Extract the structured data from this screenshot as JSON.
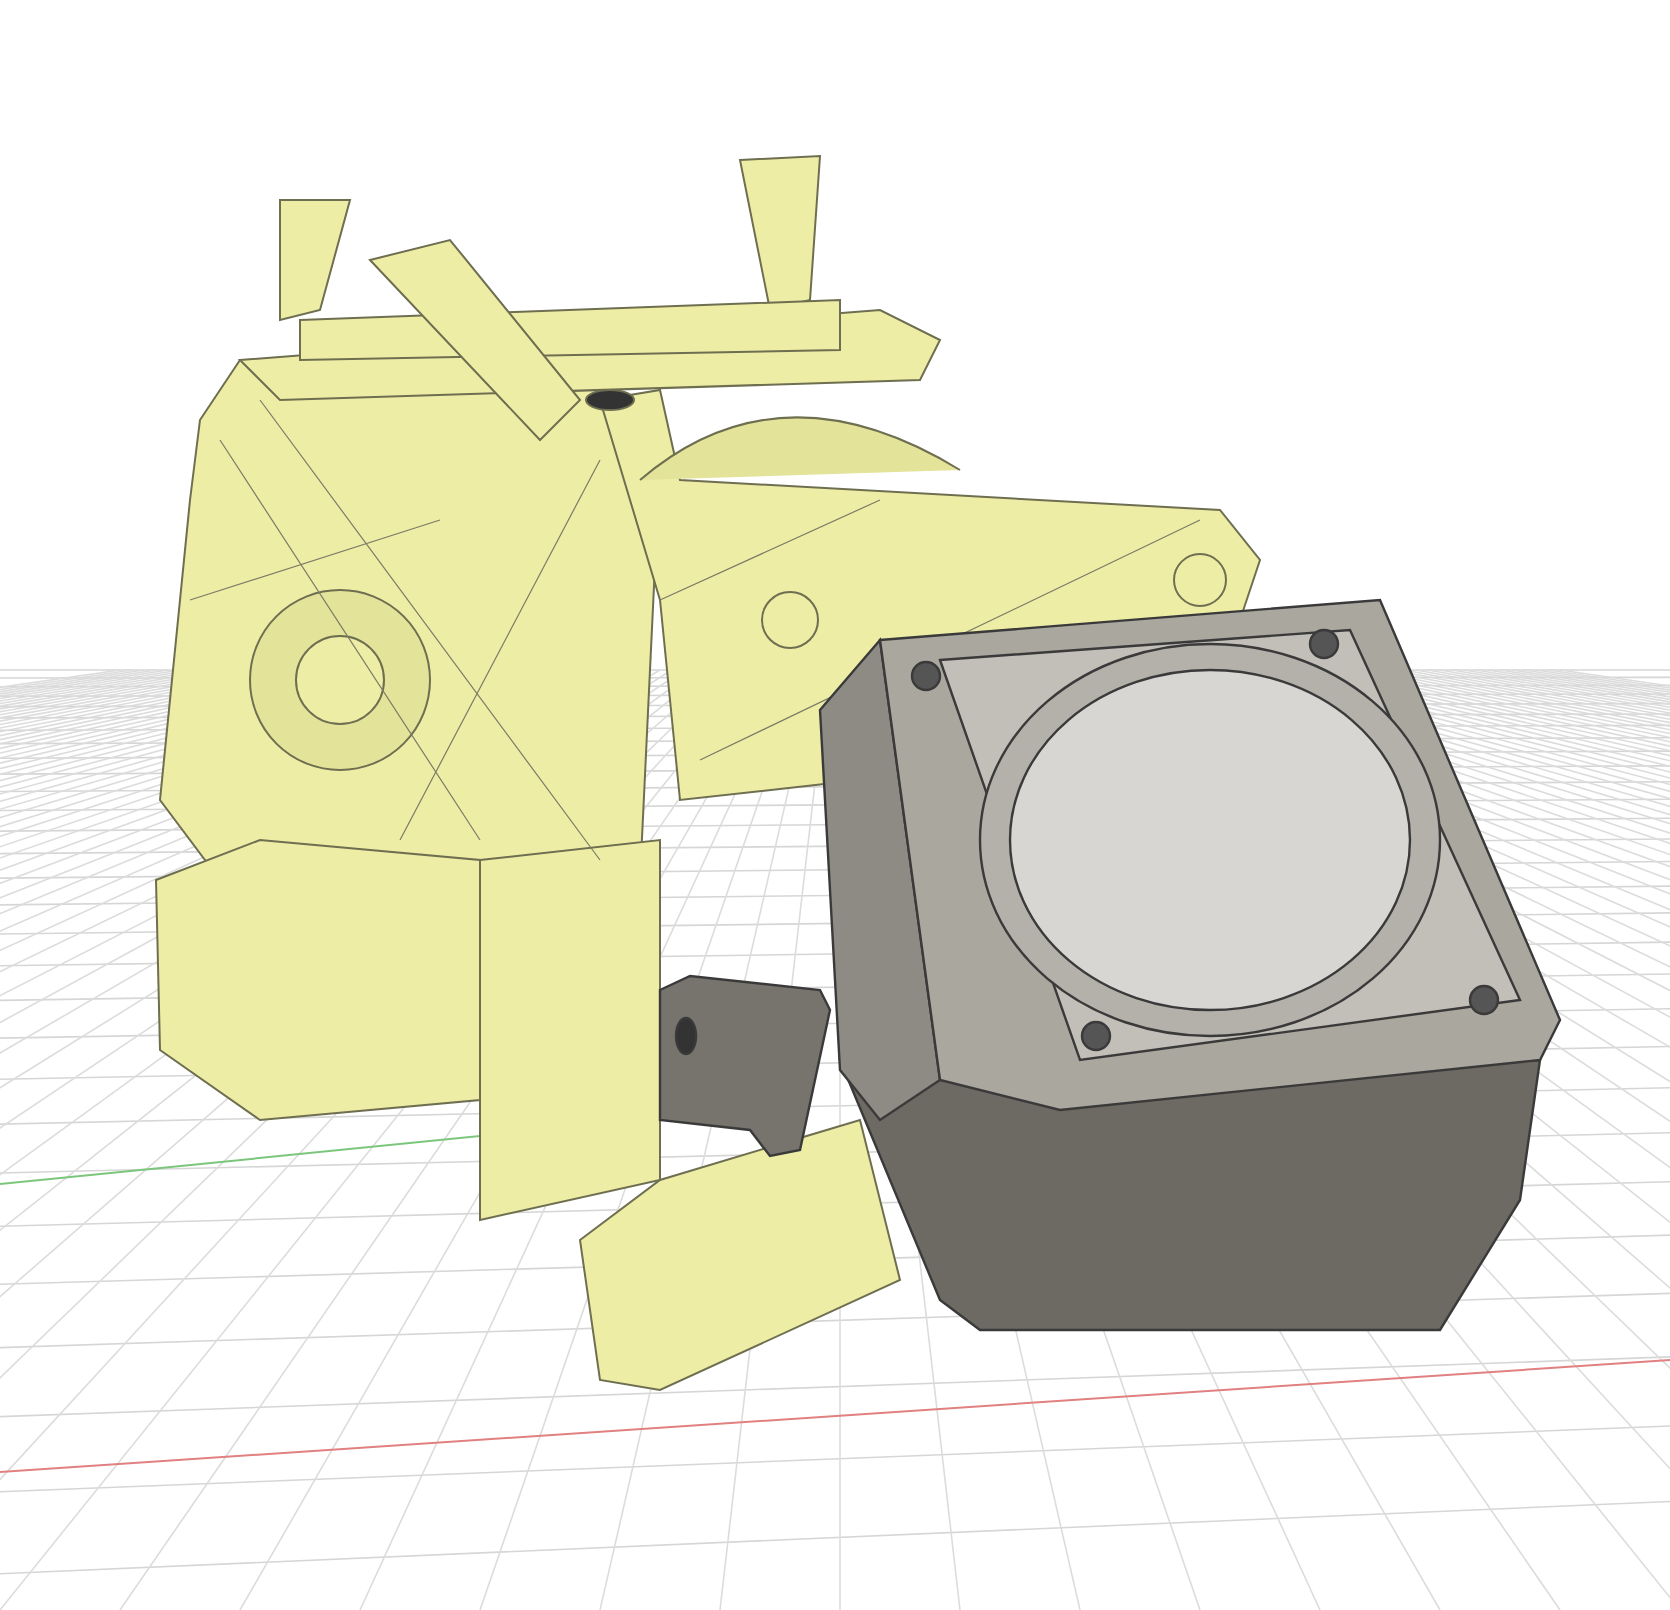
{
  "viewport": {
    "grid_visible": true
  }
}
